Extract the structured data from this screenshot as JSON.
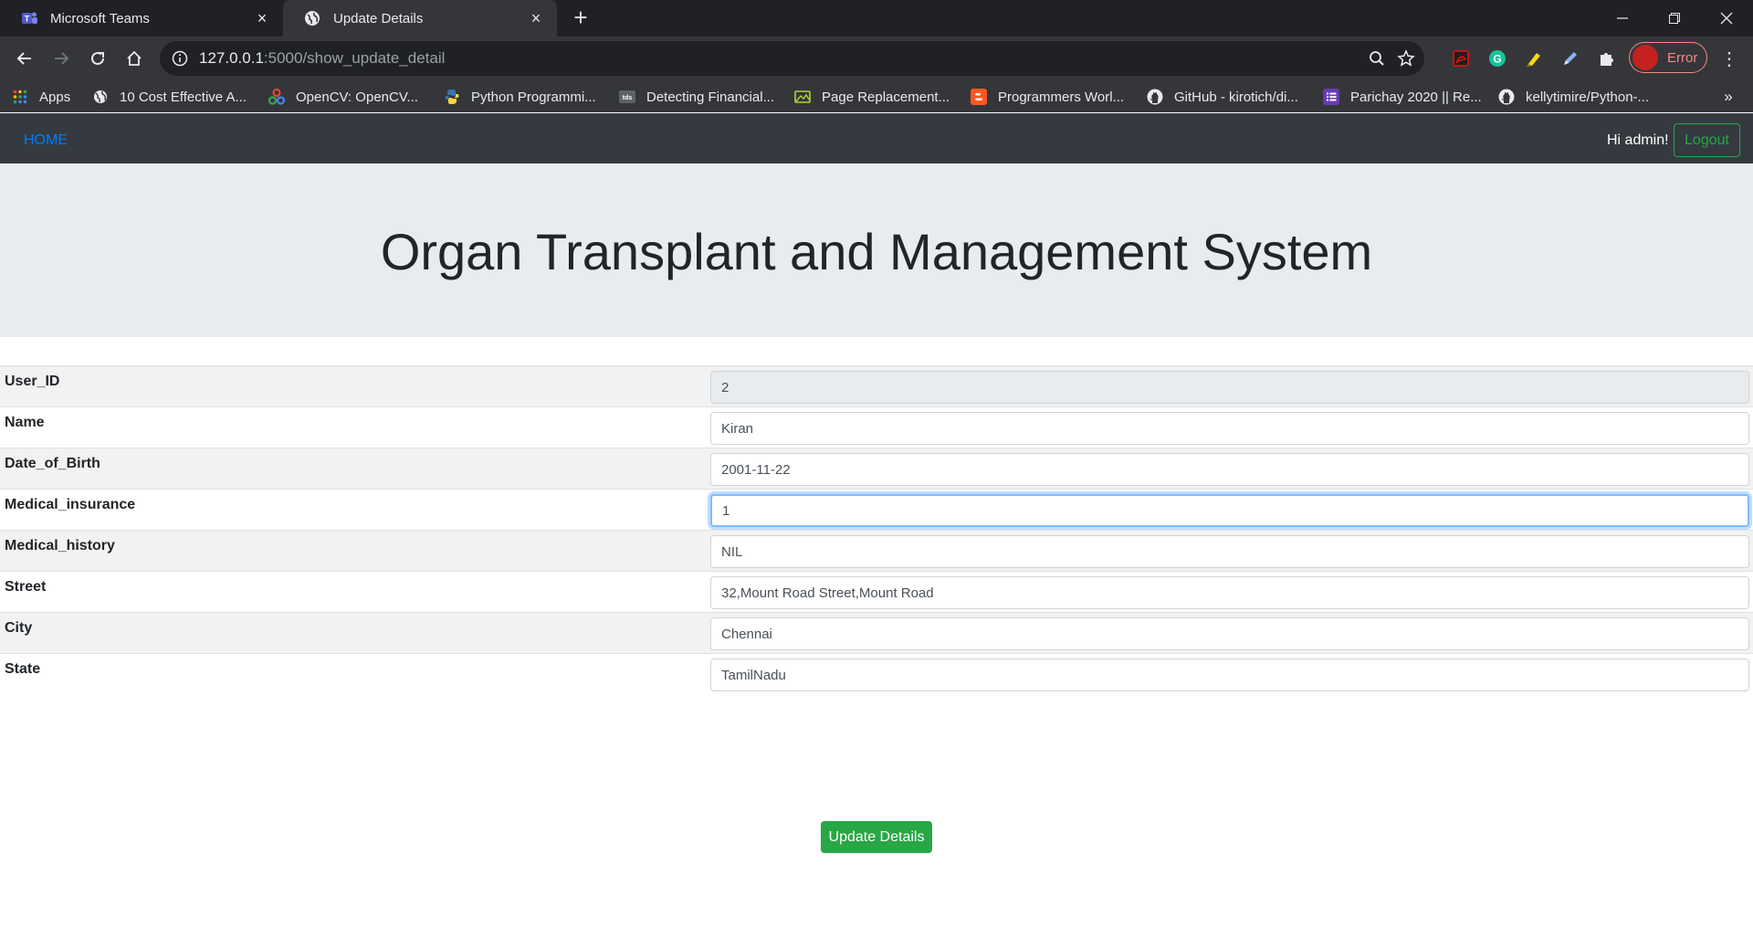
{
  "browser": {
    "tabs": [
      {
        "title": "Microsoft Teams",
        "icon": "teams-icon",
        "active": false
      },
      {
        "title": "Update Details",
        "icon": "globe-icon",
        "active": true
      }
    ],
    "url_host": "127.0.0.1",
    "url_path": ":5000/show_update_detail",
    "profile_status": "Error",
    "bookmarks": [
      {
        "label": "Apps",
        "icon": "apps-grid-icon"
      },
      {
        "label": "10 Cost Effective A...",
        "icon": "globe-icon"
      },
      {
        "label": "OpenCV: OpenCV...",
        "icon": "opencv-icon"
      },
      {
        "label": "Python Programmi...",
        "icon": "python-icon"
      },
      {
        "label": "Detecting Financial...",
        "icon": "tds-icon"
      },
      {
        "label": "Page Replacement...",
        "icon": "image-icon"
      },
      {
        "label": "Programmers Worl...",
        "icon": "blogger-icon"
      },
      {
        "label": "GitHub - kirotich/di...",
        "icon": "github-icon"
      },
      {
        "label": "Parichay 2020 || Re...",
        "icon": "list-icon"
      },
      {
        "label": "kellytimire/Python-...",
        "icon": "github-icon"
      }
    ]
  },
  "navbar": {
    "home": "HOME",
    "greeting": "Hi admin!",
    "logout": "Logout"
  },
  "header": {
    "title": "Organ Transplant and Management System"
  },
  "form": {
    "fields": [
      {
        "label": "User_ID",
        "value": "2",
        "readonly": true
      },
      {
        "label": "Name",
        "value": "Kiran"
      },
      {
        "label": "Date_of_Birth",
        "value": "2001-11-22"
      },
      {
        "label": "Medical_insurance",
        "value": "1",
        "focused": true
      },
      {
        "label": "Medical_history",
        "value": "NIL"
      },
      {
        "label": "Street",
        "value": "32,Mount Road Street,Mount Road"
      },
      {
        "label": "City",
        "value": "Chennai"
      },
      {
        "label": "State",
        "value": "TamilNadu"
      }
    ],
    "submit": "Update Details"
  },
  "colors": {
    "navbar_bg": "#343a40",
    "link": "#007bff",
    "success": "#28a745",
    "jumbotron_bg": "#e9ecef"
  }
}
